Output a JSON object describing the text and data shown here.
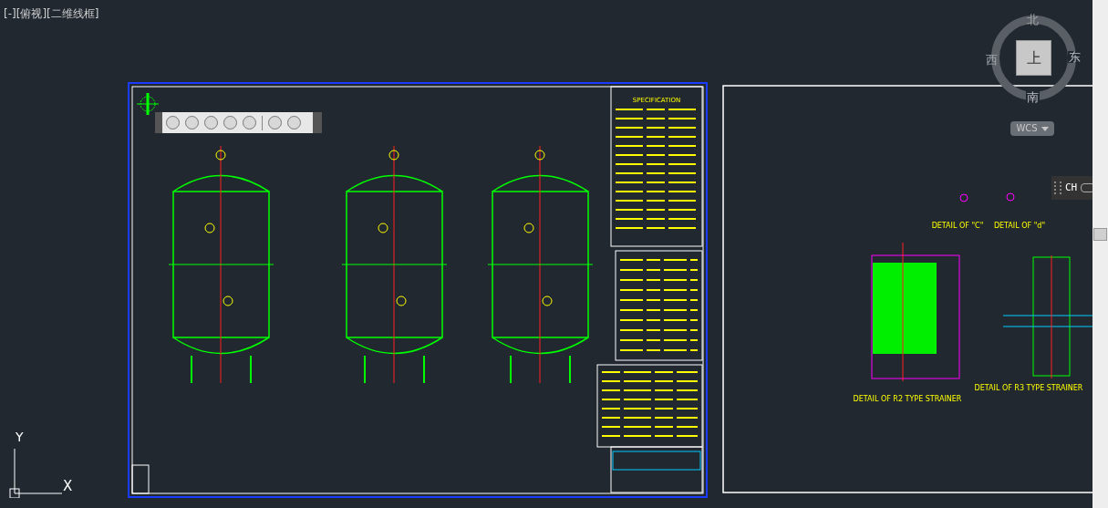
{
  "viewport_label": "[-][俯视][二维线框]",
  "viewcube": {
    "face": "上",
    "north": "北",
    "south": "南",
    "west": "西",
    "east": "东"
  },
  "wcs_button": "WCS",
  "language_bar": "CH",
  "ucs": {
    "x": "X",
    "y": "Y"
  },
  "sheets": [
    {
      "kind": "vessels",
      "labels": [
        "SPECIFICATION"
      ]
    },
    {
      "kind": "details",
      "labels": [
        "DETAIL OF \"C\"",
        "DETAIL OF \"d\"",
        "DETAIL OF R2 TYPE STRAINER",
        "DETAIL OF R3 TYPE STRAINER"
      ]
    }
  ]
}
